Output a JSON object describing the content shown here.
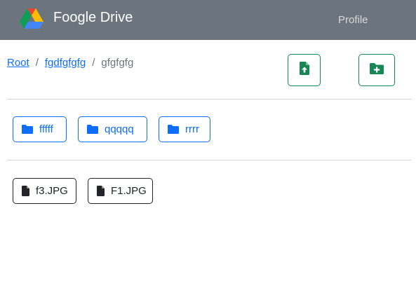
{
  "navbar": {
    "brand": "Foogle Drive",
    "profile_label": "Profile",
    "logo_icon": "drive-logo-icon",
    "background": "#6c757d"
  },
  "breadcrumb": {
    "items": [
      {
        "label": "Root",
        "link": true
      },
      {
        "label": "fgdfgfgfg",
        "link": true
      },
      {
        "label": "gfgfgfg",
        "link": false
      }
    ],
    "separator": "/"
  },
  "actions": {
    "upload_icon": "file-upload-icon",
    "new_folder_icon": "folder-plus-icon",
    "color": "#198754"
  },
  "folders": [
    {
      "name": "fffff",
      "icon": "folder-icon"
    },
    {
      "name": "qqqqq",
      "icon": "folder-icon"
    },
    {
      "name": "rrrr",
      "icon": "folder-icon"
    }
  ],
  "files": [
    {
      "name": "f3.JPG",
      "icon": "file-icon"
    },
    {
      "name": "F1.JPG",
      "icon": "file-icon"
    }
  ],
  "colors": {
    "primary": "#0d6efd",
    "success": "#198754",
    "dark": "#212529"
  }
}
